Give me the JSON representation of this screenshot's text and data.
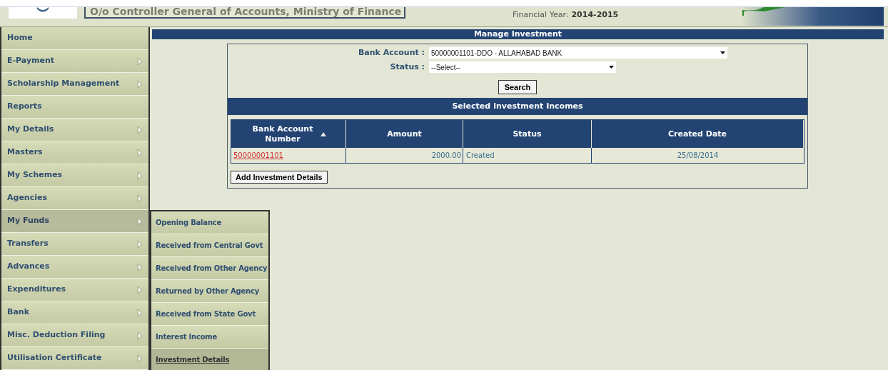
{
  "header": {
    "title": "O/o Controller General of Accounts, Ministry of Finance",
    "financial_year_label": "Financial Year:",
    "financial_year": "2014-2015"
  },
  "sidebar": {
    "items": [
      {
        "label": "Home",
        "has_submenu": false,
        "selected": false
      },
      {
        "label": "E-Payment",
        "has_submenu": true,
        "selected": false
      },
      {
        "label": "Scholarship Management",
        "has_submenu": true,
        "selected": false
      },
      {
        "label": "Reports",
        "has_submenu": false,
        "selected": false
      },
      {
        "label": "My Details",
        "has_submenu": true,
        "selected": false
      },
      {
        "label": "Masters",
        "has_submenu": true,
        "selected": false
      },
      {
        "label": "My Schemes",
        "has_submenu": true,
        "selected": false
      },
      {
        "label": "Agencies",
        "has_submenu": true,
        "selected": false
      },
      {
        "label": "My Funds",
        "has_submenu": true,
        "selected": true
      },
      {
        "label": "Transfers",
        "has_submenu": true,
        "selected": false
      },
      {
        "label": "Advances",
        "has_submenu": true,
        "selected": false
      },
      {
        "label": "Expenditures",
        "has_submenu": true,
        "selected": false
      },
      {
        "label": "Bank",
        "has_submenu": true,
        "selected": false
      },
      {
        "label": "Misc. Deduction Filing",
        "has_submenu": true,
        "selected": false
      },
      {
        "label": "Utilisation Certificate",
        "has_submenu": true,
        "selected": false
      }
    ]
  },
  "submenu": {
    "items": [
      {
        "label": "Opening Balance",
        "selected": false
      },
      {
        "label": "Received from Central Govt",
        "selected": false
      },
      {
        "label": "Received from Other Agency",
        "selected": false
      },
      {
        "label": "Returned by Other Agency",
        "selected": false
      },
      {
        "label": "Received from State Govt",
        "selected": false
      },
      {
        "label": "Interest Income",
        "selected": false
      },
      {
        "label": "Investment Details",
        "selected": true
      }
    ]
  },
  "panel": {
    "title": "Manage Investment",
    "fields": [
      {
        "label": "Bank Account :",
        "value": "50000001101-DDO - ALLAHABAD BANK"
      },
      {
        "label": "Status :",
        "value": "--Select--"
      }
    ],
    "search_button": "Search",
    "table": {
      "title": "Selected Investment Incomes",
      "columns": [
        {
          "label": "Bank Account Number",
          "sorted": true
        },
        {
          "label": "Amount",
          "sorted": false
        },
        {
          "label": "Status",
          "sorted": false
        },
        {
          "label": "Created Date",
          "sorted": false
        }
      ],
      "rows": [
        {
          "account": "50000001101",
          "amount": "2000.00",
          "status": "Created",
          "created_date": "25/08/2014"
        }
      ]
    },
    "add_button": "Add Investment Details"
  }
}
